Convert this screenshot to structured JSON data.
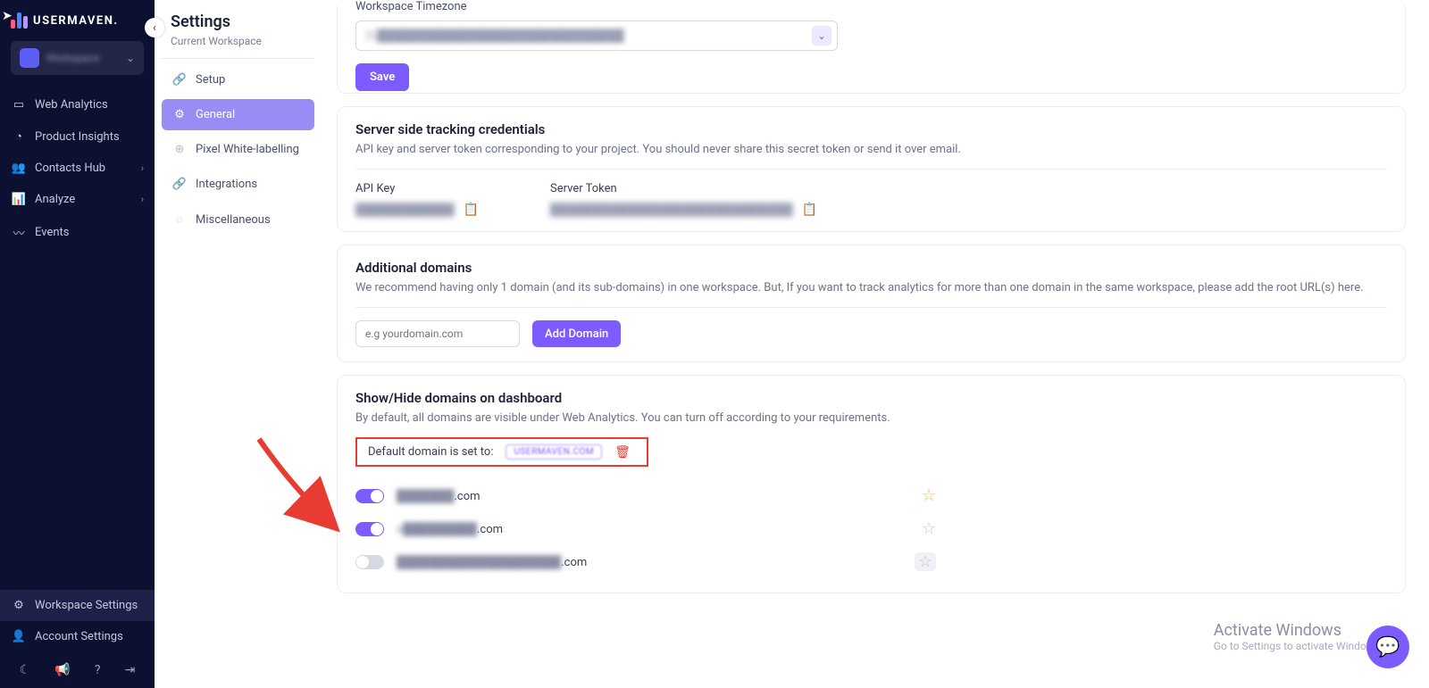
{
  "brand": "USERMAVEN.",
  "workspace": {
    "name": "Workspace"
  },
  "nav": {
    "web_analytics": "Web Analytics",
    "product_insights": "Product Insights",
    "contacts_hub": "Contacts Hub",
    "analyze": "Analyze",
    "events": "Events",
    "workspace_settings": "Workspace Settings",
    "account_settings": "Account Settings"
  },
  "settings": {
    "title": "Settings",
    "subtitle": "Current Workspace",
    "items": {
      "setup": "Setup",
      "general": "General",
      "pixel": "Pixel White-labelling",
      "integrations": "Integrations",
      "misc": "Miscellaneous"
    }
  },
  "timezone": {
    "label": "Workspace Timezone",
    "value": "(G██████████████████████████████",
    "save": "Save"
  },
  "server_tracking": {
    "title": "Server side tracking credentials",
    "desc": "API key and server token corresponding to your project. You should never share this secret token or send it over email.",
    "api_key_label": "API Key",
    "api_key_value": "████████████",
    "server_token_label": "Server Token",
    "server_token_value": "████████████████████████████"
  },
  "additional_domains": {
    "title": "Additional domains",
    "desc": "We recommend having only 1 domain (and its sub-domains) in one workspace. But, If you want to track analytics for more than one domain in the same workspace, please add the root URL(s) here.",
    "placeholder": "e.g yourdomain.com",
    "add_btn": "Add Domain"
  },
  "show_hide": {
    "title": "Show/Hide domains on dashboard",
    "desc": "By default, all domains are visible under Web Analytics. You can turn off according to your requirements.",
    "default_label": "Default domain is set to:",
    "default_badge": "USERMAVEN.COM",
    "rows": [
      {
        "on": true,
        "masked": "███████",
        "suffix": ".com",
        "star": "gold"
      },
      {
        "on": true,
        "masked": "a█████████",
        "suffix": ".com",
        "star": "gray"
      },
      {
        "on": false,
        "masked": "████████████████████",
        "suffix": ".com",
        "star": "boxed"
      }
    ]
  },
  "activate": {
    "t1": "Activate Windows",
    "t2": "Go to Settings to activate Windows"
  }
}
